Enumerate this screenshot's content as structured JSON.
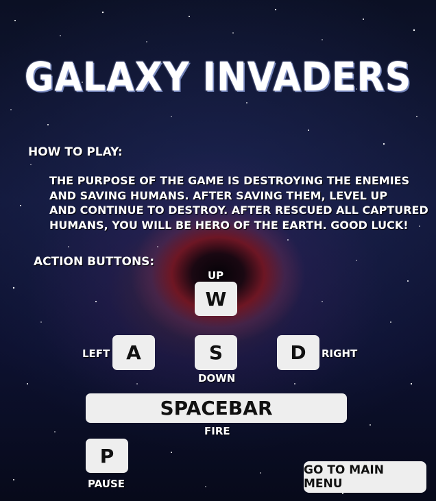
{
  "title": "GALAXY INVADERS",
  "how_to_play": {
    "heading": "HOW TO PLAY:",
    "lines": [
      "THE PURPOSE OF THE GAME IS DESTROYING  THE ENEMIES",
      "AND SAVING HUMANS. AFTER SAVING THEM, LEVEL UP",
      "AND CONTINUE TO DESTROY. AFTER RESCUED ALL CAPTURED",
      "HUMANS, YOU WILL BE HERO OF THE EARTH. GOOD LUCK!"
    ]
  },
  "action_buttons": {
    "heading": "ACTION BUTTONS:",
    "keys": {
      "w": {
        "key": "W",
        "label": "UP"
      },
      "a": {
        "key": "A",
        "label": "LEFT"
      },
      "s": {
        "key": "S",
        "label": "DOWN"
      },
      "d": {
        "key": "D",
        "label": "RIGHT"
      },
      "space": {
        "key": "SPACEBAR",
        "label": "FIRE"
      },
      "p": {
        "key": "P",
        "label": "PAUSE"
      }
    }
  },
  "main_menu_button": "GO TO MAIN MENU",
  "colors": {
    "key_background": "#eeeeee",
    "text": "#ffffff",
    "key_text": "#111111"
  }
}
